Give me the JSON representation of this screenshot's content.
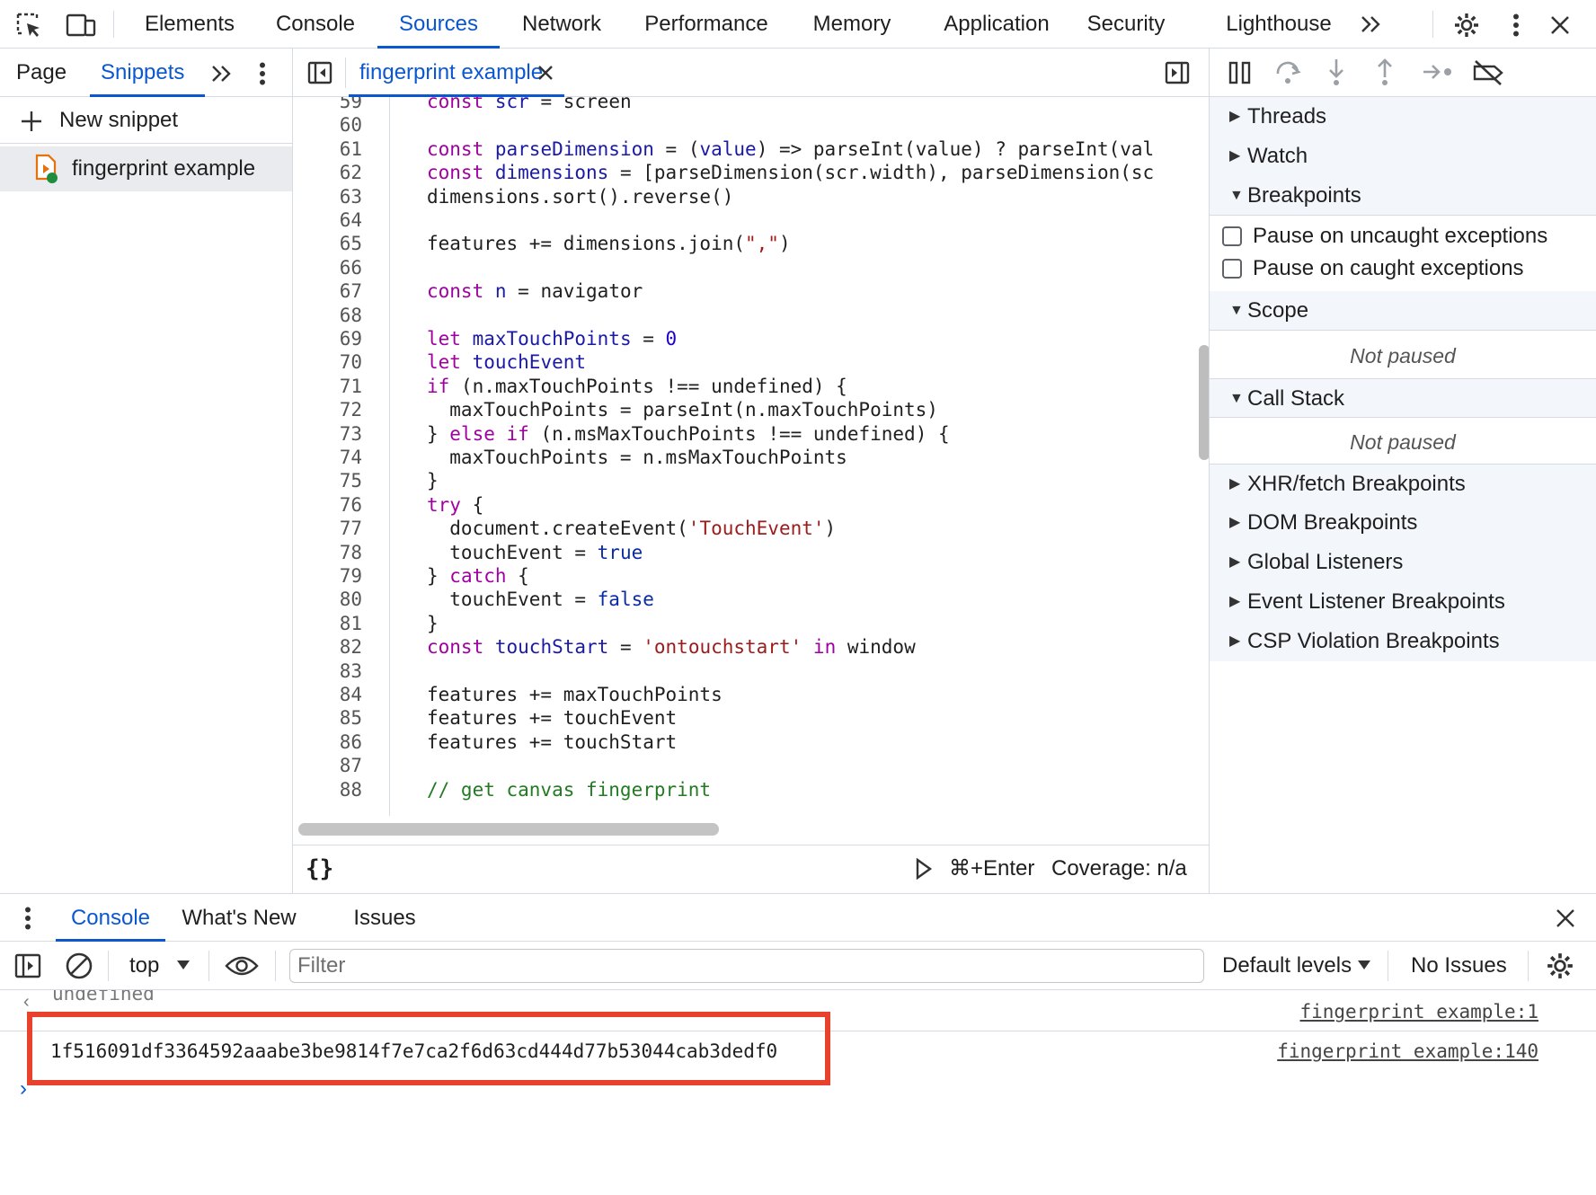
{
  "topbar": {
    "tabs": [
      {
        "label": "Elements"
      },
      {
        "label": "Console"
      },
      {
        "label": "Sources"
      },
      {
        "label": "Network"
      },
      {
        "label": "Performance"
      },
      {
        "label": "Memory"
      },
      {
        "label": "Application"
      },
      {
        "label": "Security"
      },
      {
        "label": "Lighthouse"
      }
    ],
    "active_tab": "Sources"
  },
  "navigator": {
    "tabs": [
      {
        "label": "Page"
      },
      {
        "label": "Snippets"
      }
    ],
    "active_tab": "Snippets",
    "new_snippet_label": "New snippet",
    "files": [
      {
        "name": "fingerprint example"
      }
    ]
  },
  "editor": {
    "open_tab": "fingerprint example",
    "footer": {
      "run_shortcut": "⌘+Enter",
      "coverage": "Coverage: n/a"
    },
    "lines": [
      {
        "n": "59",
        "html": "<span class=\"kw\">const</span> <span class=\"var\">scr</span> = screen"
      },
      {
        "n": "60",
        "html": ""
      },
      {
        "n": "61",
        "html": "<span class=\"kw\">const</span> <span class=\"var\">parseDimension</span> = (<span class=\"var\">value</span>) =&gt; parseInt(value) ? parseInt(val"
      },
      {
        "n": "62",
        "html": "<span class=\"kw\">const</span> <span class=\"var\">dimensions</span> = [parseDimension(scr.width), parseDimension(sc"
      },
      {
        "n": "63",
        "html": "dimensions.sort().reverse()"
      },
      {
        "n": "64",
        "html": ""
      },
      {
        "n": "65",
        "html": "features += dimensions.join(<span class=\"str\">\",\"</span>)"
      },
      {
        "n": "66",
        "html": ""
      },
      {
        "n": "67",
        "html": "<span class=\"kw\">const</span> <span class=\"var\">n</span> = navigator"
      },
      {
        "n": "68",
        "html": ""
      },
      {
        "n": "69",
        "html": "<span class=\"kw\">let</span> <span class=\"var\">maxTouchPoints</span> = <span class=\"num\">0</span>"
      },
      {
        "n": "70",
        "html": "<span class=\"kw\">let</span> <span class=\"var\">touchEvent</span>"
      },
      {
        "n": "71",
        "html": "<span class=\"kw\">if</span> (n.maxTouchPoints !== undefined) {"
      },
      {
        "n": "72",
        "html": "  maxTouchPoints = parseInt(n.maxTouchPoints)"
      },
      {
        "n": "73",
        "html": "} <span class=\"kw\">else</span> <span class=\"kw\">if</span> (n.msMaxTouchPoints !== undefined) {"
      },
      {
        "n": "74",
        "html": "  maxTouchPoints = n.msMaxTouchPoints"
      },
      {
        "n": "75",
        "html": "}"
      },
      {
        "n": "76",
        "html": "<span class=\"kw\">try</span> {"
      },
      {
        "n": "77",
        "html": "  document.createEvent(<span class=\"str\">'TouchEvent'</span>)"
      },
      {
        "n": "78",
        "html": "  touchEvent = <span class=\"bool\">true</span>"
      },
      {
        "n": "79",
        "html": "} <span class=\"kw\">catch</span> {"
      },
      {
        "n": "80",
        "html": "  touchEvent = <span class=\"bool\">false</span>"
      },
      {
        "n": "81",
        "html": "}"
      },
      {
        "n": "82",
        "html": "<span class=\"kw\">const</span> <span class=\"var\">touchStart</span> = <span class=\"str\">'ontouchstart'</span> <span class=\"kw\">in</span> window"
      },
      {
        "n": "83",
        "html": ""
      },
      {
        "n": "84",
        "html": "features += maxTouchPoints"
      },
      {
        "n": "85",
        "html": "features += touchEvent"
      },
      {
        "n": "86",
        "html": "features += touchStart"
      },
      {
        "n": "87",
        "html": ""
      },
      {
        "n": "88",
        "html": "<span class=\"cmt\">// get canvas fingerprint</span>"
      }
    ]
  },
  "debugger": {
    "sections": {
      "threads": "Threads",
      "watch": "Watch",
      "breakpoints": "Breakpoints",
      "pause_uncaught": "Pause on uncaught exceptions",
      "pause_caught": "Pause on caught exceptions",
      "scope": "Scope",
      "scope_status": "Not paused",
      "call_stack": "Call Stack",
      "call_stack_status": "Not paused",
      "xhr": "XHR/fetch Breakpoints",
      "dom": "DOM Breakpoints",
      "global": "Global Listeners",
      "event_listener": "Event Listener Breakpoints",
      "csp": "CSP Violation Breakpoints"
    }
  },
  "drawer": {
    "tabs": [
      {
        "label": "Console"
      },
      {
        "label": "What's New"
      },
      {
        "label": "Issues"
      }
    ],
    "active_tab": "Console"
  },
  "console": {
    "context": "top",
    "filter_placeholder": "Filter",
    "levels": "Default levels",
    "issues": "No Issues",
    "messages": [
      {
        "text": "undefined",
        "source": "fingerprint example:1"
      },
      {
        "text": "1f516091df3364592aaabe3be9814f7e7ca2f6d63cd444d77b53044cab3dedf0",
        "source": "fingerprint example:140"
      }
    ],
    "highlight_color": "#e8412c"
  }
}
